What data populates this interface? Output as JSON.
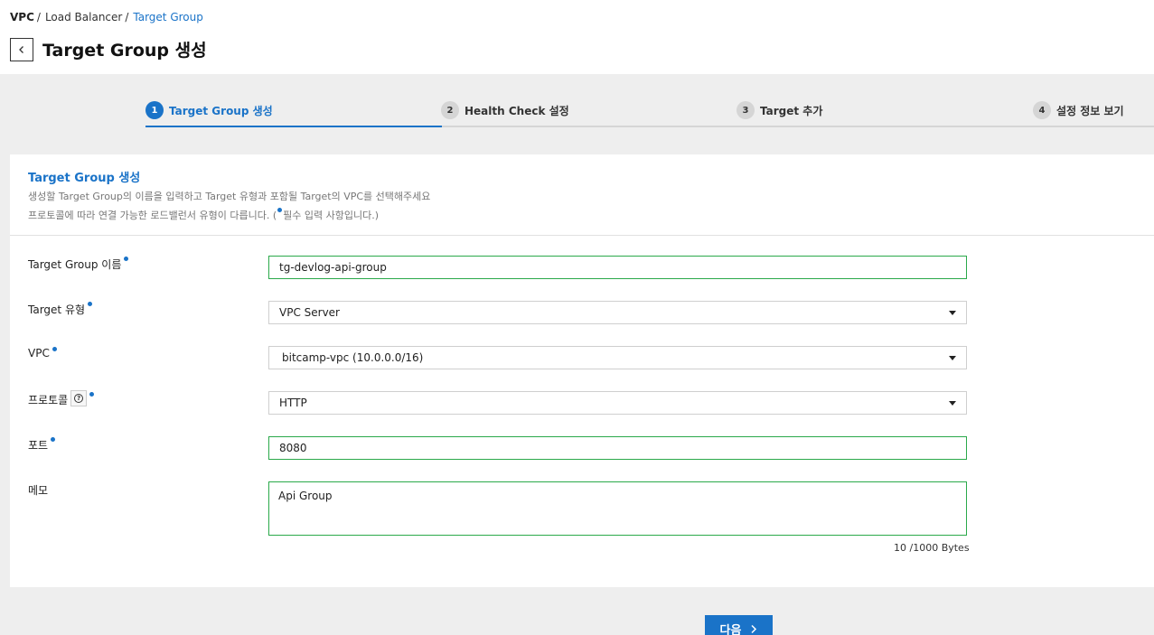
{
  "breadcrumb": {
    "root": "VPC",
    "sep1": "/",
    "middle": "Load Balancer",
    "sep2": "/",
    "current": "Target Group"
  },
  "page": {
    "title": "Target Group 생성",
    "back_icon": "chevron-left-icon"
  },
  "steps": [
    {
      "num": "1",
      "label": "Target Group 생성",
      "active": true
    },
    {
      "num": "2",
      "label": "Health Check 설정",
      "active": false
    },
    {
      "num": "3",
      "label": "Target 추가",
      "active": false
    },
    {
      "num": "4",
      "label": "설정 정보 보기",
      "active": false
    }
  ],
  "section": {
    "title": "Target Group 생성",
    "desc1": "생성할 Target Group의 이름을 입력하고 Target 유형과 포함될 Target의 VPC를 선택해주세요",
    "desc2_prefix": "프로토콜에 따라 연결 가능한 로드밸런서 유형이 다릅니다. (",
    "desc2_suffix": "필수 입력 사항입니다.)"
  },
  "form": {
    "name": {
      "label": "Target Group 이름",
      "value": "tg-devlog-api-group"
    },
    "target_type": {
      "label": "Target 유형",
      "value": "VPC Server"
    },
    "vpc": {
      "label": "VPC",
      "value": "bitcamp-vpc (10.0.0.0/16)"
    },
    "protocol": {
      "label": "프로토콜",
      "value": "HTTP",
      "help_icon": "question-circle-icon"
    },
    "port": {
      "label": "포트",
      "value": "8080"
    },
    "memo": {
      "label": "메모",
      "value": "Api Group",
      "byte_count": "10 /1000 Bytes"
    }
  },
  "actions": {
    "next_label": "다음",
    "next_icon": "chevron-right-icon"
  },
  "colors": {
    "accent": "#1a73c8",
    "valid_border": "#2aa94a",
    "background": "#eeeeee"
  }
}
